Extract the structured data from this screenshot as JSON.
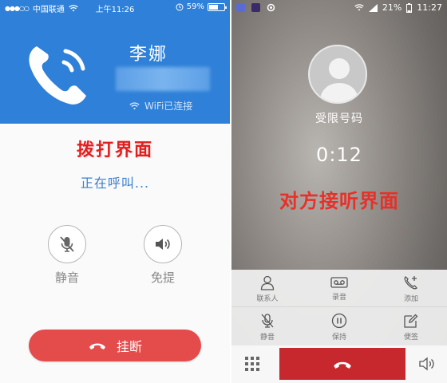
{
  "left": {
    "status": {
      "carrier": "中国联通",
      "time": "上午11:26",
      "battery": "59%",
      "battery_level": 0.59
    },
    "contact_name": "李娜",
    "wifi_status": "WiFi已连接",
    "screen_label": "拨打界面",
    "calling_text": "正在呼叫...",
    "mute_label": "静音",
    "speaker_label": "免提",
    "hangup_label": "挂断",
    "colors": {
      "header": "#2f80d8",
      "hangup": "#e44b4b",
      "label_red": "#e02020"
    }
  },
  "right": {
    "status": {
      "battery": "21%",
      "time": "11:27"
    },
    "contact_name": "受限号码",
    "timer": "0:12",
    "screen_label": "对方接听界面",
    "actions_row1": [
      {
        "icon": "person-icon",
        "label": "联系人"
      },
      {
        "icon": "tape-icon",
        "label": "录音"
      },
      {
        "icon": "add-call-icon",
        "label": "添加"
      }
    ],
    "actions_row2": [
      {
        "icon": "mic-off-icon",
        "label": "静音"
      },
      {
        "icon": "pause-icon",
        "label": "保持"
      },
      {
        "icon": "note-icon",
        "label": "便签"
      }
    ],
    "colors": {
      "end_call": "#c6282e",
      "label_red": "#e83028"
    }
  }
}
